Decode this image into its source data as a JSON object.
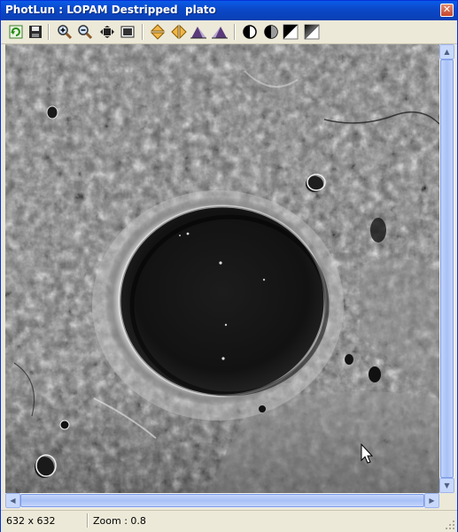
{
  "window": {
    "title": "PhotLun : LOPAM Destripped  plato",
    "close_glyph": "✕"
  },
  "toolbar": {
    "buttons": [
      {
        "name": "refresh-icon"
      },
      {
        "name": "save-icon"
      },
      {
        "name": "zoom-in-icon"
      },
      {
        "name": "zoom-out-icon"
      },
      {
        "name": "fit-window-icon"
      },
      {
        "name": "actual-size-icon"
      },
      {
        "name": "flip-vertical-icon"
      },
      {
        "name": "flip-horizontal-icon"
      },
      {
        "name": "shadow-left-icon"
      },
      {
        "name": "shadow-right-icon"
      },
      {
        "name": "contrast-icon"
      },
      {
        "name": "half-contrast-icon"
      },
      {
        "name": "invert-icon"
      },
      {
        "name": "gradient-icon"
      }
    ]
  },
  "status": {
    "size": "632 x 632",
    "zoom": "Zoom : 0.8"
  },
  "colors": {
    "titlebar": "#0b49c9",
    "scroll_thumb": "#a7c1f6",
    "chrome": "#ece9d8"
  },
  "image": {
    "subject": "lunar crater photograph"
  }
}
